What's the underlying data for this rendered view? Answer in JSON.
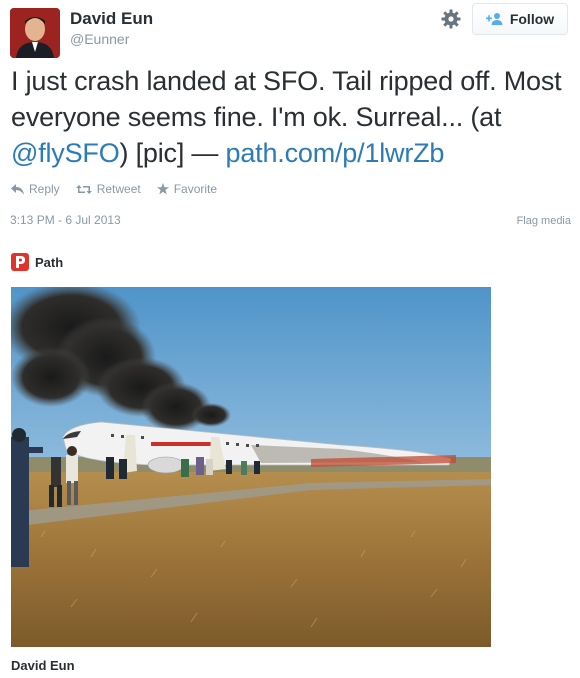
{
  "user": {
    "name": "David Eun",
    "handle": "@Eunner"
  },
  "follow_button": {
    "label": "Follow"
  },
  "tweet": {
    "text_main": "I just crash landed at SFO. Tail ripped off. Most everyone seems fine. I'm ok. Surreal... (at ",
    "mention": "@flySFO",
    "text_after_mention": ") [pic] — ",
    "link": "path.com/p/1lwrZb"
  },
  "actions": {
    "reply": "Reply",
    "retweet": "Retweet",
    "favorite": "Favorite"
  },
  "timestamp": "3:13 PM - 6 Jul 2013",
  "flag_media": "Flag media",
  "source": {
    "name": "Path"
  },
  "photo_caption": "David Eun",
  "colors": {
    "link": "#2b7bb9",
    "muted": "#8899a6",
    "text": "#292f33",
    "path_brand": "#e0332a"
  },
  "icons": [
    "gear-icon",
    "follow-person-icon",
    "reply-icon",
    "retweet-icon",
    "favorite-star-icon",
    "path-logo-icon"
  ]
}
